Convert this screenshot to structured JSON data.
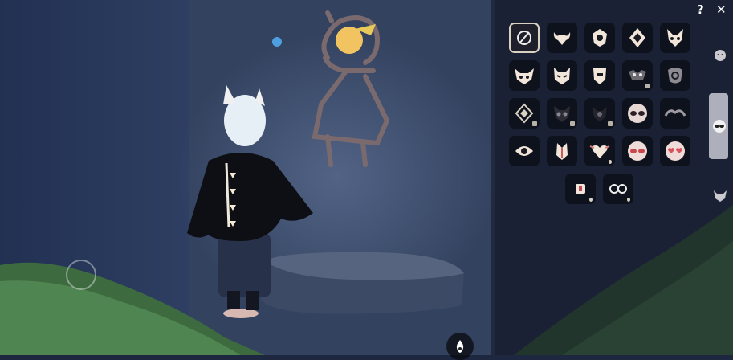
{
  "top_bar": {
    "help_label": "?",
    "close_label": "✕"
  },
  "mask_grid": {
    "rows": [
      [
        "none",
        "mask-ox",
        "mask-crest",
        "mask-diamond",
        "mask-fox"
      ],
      [
        "mask-horned",
        "mask-cat",
        "mask-shield",
        "mask-bat",
        "mask-spiral"
      ],
      [
        "mask-rhombus",
        "mask-owl-dark",
        "mask-owl-shade",
        "mask-glasses",
        "mask-wings"
      ],
      [
        "mask-eye",
        "mask-feather",
        "mask-heart",
        "mask-sunglasses-pink",
        "mask-heart-glasses"
      ],
      [
        "mask-scarf",
        "mask-round-glasses"
      ]
    ],
    "selected_index": 0,
    "locked": [
      "mask-rhombus",
      "mask-owl-dark",
      "mask-owl-shade",
      "mask-bat"
    ]
  },
  "categories": [
    {
      "icon": "face-icon",
      "selected": false
    },
    {
      "icon": "sunglasses-icon",
      "selected": true
    },
    {
      "icon": "horned-mask-icon",
      "selected": false
    }
  ],
  "colors": {
    "accent": "#f2c461",
    "panel": "#121622",
    "frame": "#d9d2c3"
  }
}
